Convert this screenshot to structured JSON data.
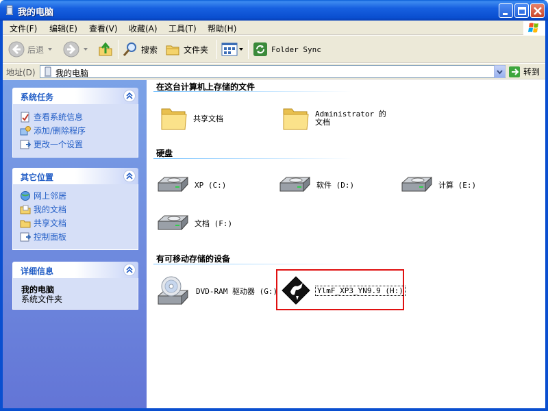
{
  "window": {
    "title": "我的电脑"
  },
  "menu": [
    "文件(F)",
    "编辑(E)",
    "查看(V)",
    "收藏(A)",
    "工具(T)",
    "帮助(H)"
  ],
  "toolbar": {
    "back": "后退",
    "search": "搜索",
    "folders": "文件夹",
    "folder_sync": "Folder Sync"
  },
  "address": {
    "label": "地址(D)",
    "value": "我的电脑",
    "go": "转到"
  },
  "tasks": {
    "system": {
      "title": "系统任务",
      "items": [
        "查看系统信息",
        "添加/删除程序",
        "更改一个设置"
      ]
    },
    "other": {
      "title": "其它位置",
      "items": [
        "网上邻居",
        "我的文档",
        "共享文档",
        "控制面板"
      ]
    },
    "details": {
      "title": "详细信息",
      "name": "我的电脑",
      "desc": "系统文件夹"
    }
  },
  "groups": {
    "files": {
      "title": "在这台计算机上存储的文件",
      "items": [
        "共享文档",
        "Administrator 的文档"
      ]
    },
    "disks": {
      "title": "硬盘",
      "items": [
        "XP (C:)",
        "软件 (D:)",
        "计算 (E:)",
        "文档 (F:)"
      ]
    },
    "removable": {
      "title": "有可移动存储的设备",
      "items": [
        "DVD-RAM 驱动器 (G:)",
        "YlmF_XP3_YN9.9 (H:)"
      ]
    }
  },
  "colors": {
    "title_bar": "#0a4fd0",
    "task_link": "#215dc6",
    "highlight": "#e01010"
  }
}
